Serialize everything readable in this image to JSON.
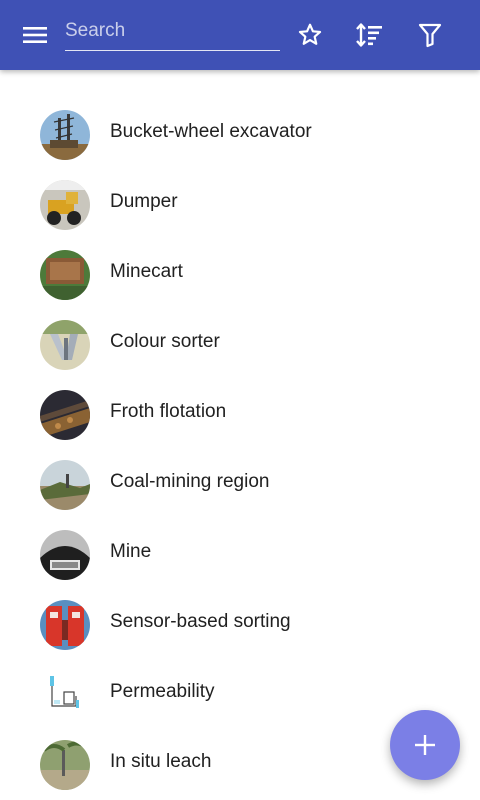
{
  "toolbar": {
    "search_placeholder": "Search",
    "search_value": "",
    "menu_icon": "hamburger-menu-icon",
    "favorite_icon": "star-outline-icon",
    "sort_icon": "sort-icon",
    "filter_icon": "filter-icon",
    "color": "#3f51b5"
  },
  "items": [
    {
      "label": "Bucket-wheel excavator",
      "thumbnail": "excavator-photo"
    },
    {
      "label": "Dumper",
      "thumbnail": "dumper-photo"
    },
    {
      "label": "Minecart",
      "thumbnail": "minecart-photo"
    },
    {
      "label": "Colour sorter",
      "thumbnail": "colour-sorter-photo"
    },
    {
      "label": "Froth flotation",
      "thumbnail": "froth-flotation-photo"
    },
    {
      "label": "Coal-mining region",
      "thumbnail": "coal-mining-photo"
    },
    {
      "label": "Mine",
      "thumbnail": "mine-photo"
    },
    {
      "label": "Sensor-based sorting",
      "thumbnail": "sensor-sorting-photo"
    },
    {
      "label": "Permeability",
      "thumbnail": "permeability-diagram"
    },
    {
      "label": "In situ leach",
      "thumbnail": "in-situ-leach-photo"
    }
  ],
  "fab": {
    "icon": "plus-icon",
    "color": "#7b7fe6"
  }
}
